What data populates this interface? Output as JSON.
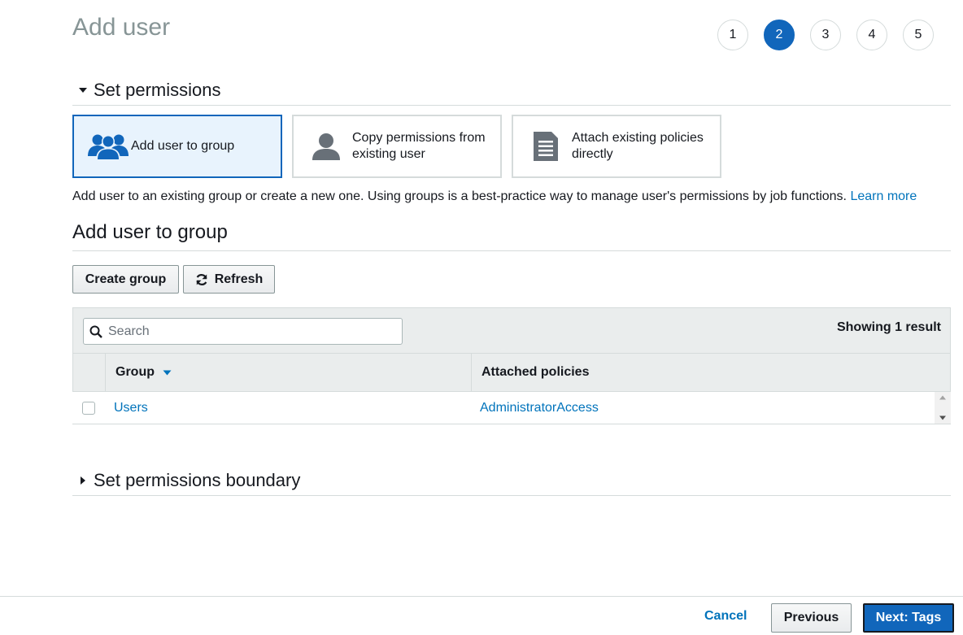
{
  "page": {
    "title": "Add user"
  },
  "steps": [
    "1",
    "2",
    "3",
    "4",
    "5"
  ],
  "current_step": "2",
  "set_permissions": {
    "heading": "Set permissions",
    "options": [
      {
        "label": "Add user to group",
        "icon": "users-group-icon",
        "selected": true
      },
      {
        "label": "Copy permissions from existing user",
        "icon": "user-icon",
        "selected": false
      },
      {
        "label": "Attach existing policies directly",
        "icon": "document-icon",
        "selected": false
      }
    ],
    "description": "Add user to an existing group or create a new one. Using groups is a best-practice way to manage user's permissions by job functions.",
    "learn_more": "Learn more"
  },
  "group_section": {
    "heading": "Add user to group",
    "create_group_label": "Create group",
    "refresh_label": "Refresh",
    "search_placeholder": "Search",
    "result_count": "Showing 1 result",
    "columns": {
      "group": "Group",
      "policies": "Attached policies"
    },
    "rows": [
      {
        "group": "Users",
        "policies": "AdministratorAccess"
      }
    ]
  },
  "boundary": {
    "heading": "Set permissions boundary"
  },
  "footer": {
    "cancel": "Cancel",
    "previous": "Previous",
    "next": "Next: Tags"
  },
  "colors": {
    "primary": "#1166bb",
    "link": "#0073bb",
    "border": "#d5dbdb",
    "selected_bg": "#e8f3fd"
  }
}
